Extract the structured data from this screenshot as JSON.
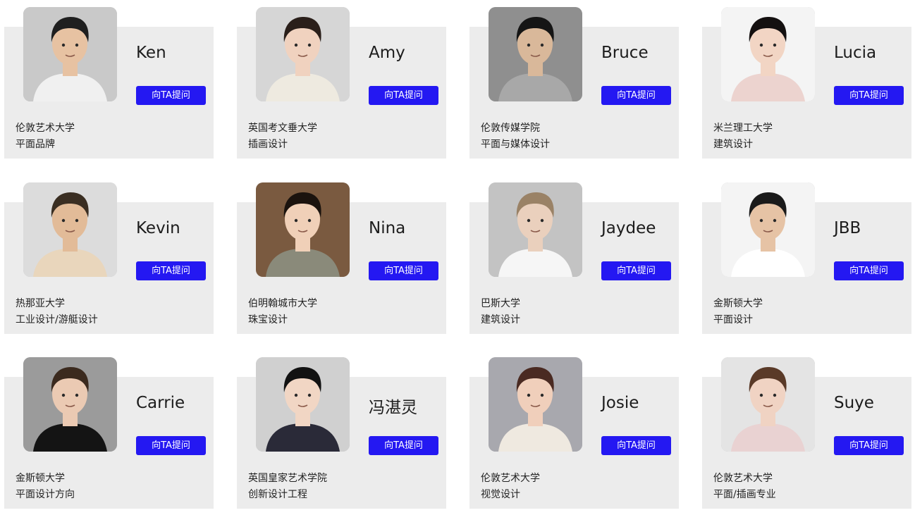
{
  "ask_label": "向TA提问",
  "accent_color": "#2418f2",
  "card_bg": "#ececec",
  "mentors": [
    {
      "name": "Ken",
      "school": "伦敦艺术大学",
      "major": "平面品牌",
      "photo": {
        "bg": "#c9c9c9",
        "skin": "#e7c2a2",
        "hair": "#1f1f1f",
        "shirt": "#f0f0f0"
      }
    },
    {
      "name": "Amy",
      "school": "英国考文垂大学",
      "major": "插画设计",
      "photo": {
        "bg": "#d6d6d6",
        "skin": "#f0d2bf",
        "hair": "#2a1f1a",
        "shirt": "#eeeae0"
      }
    },
    {
      "name": "Bruce",
      "school": "伦敦传媒学院",
      "major": "平面与媒体设计",
      "photo": {
        "bg": "#8f8f8f",
        "skin": "#d9b89a",
        "hair": "#151515",
        "shirt": "#a8a8a8"
      }
    },
    {
      "name": "Lucia",
      "school": "米兰理工大学",
      "major": "建筑设计",
      "photo": {
        "bg": "#f4f4f4",
        "skin": "#f2d5c4",
        "hair": "#141010",
        "shirt": "#ecd3cf"
      }
    },
    {
      "name": "Kevin",
      "school": "热那亚大学",
      "major": "工业设计/游艇设计",
      "photo": {
        "bg": "#dcdcdc",
        "skin": "#e2bb98",
        "hair": "#3a2e22",
        "shirt": "#e9d6bc"
      }
    },
    {
      "name": "Nina",
      "school": "伯明翰城市大学",
      "major": "珠宝设计",
      "photo": {
        "bg": "#7a5a40",
        "skin": "#f0d0b8",
        "hair": "#1b130e",
        "shirt": "#8a8a7a"
      }
    },
    {
      "name": "Jaydee",
      "school": "巴斯大学",
      "major": "建筑设计",
      "photo": {
        "bg": "#c3c3c3",
        "skin": "#ead0bd",
        "hair": "#9a8266",
        "shirt": "#f6f6f6"
      }
    },
    {
      "name": "JBB",
      "school": "金斯顿大学",
      "major": "平面设计",
      "photo": {
        "bg": "#f4f4f4",
        "skin": "#e6c3a5",
        "hair": "#1a1a1a",
        "shirt": "#ffffff"
      }
    },
    {
      "name": "Carrie",
      "school": "金斯顿大学",
      "major": "平面设计方向",
      "photo": {
        "bg": "#9b9b9b",
        "skin": "#ebcab3",
        "hair": "#3b2a1e",
        "shirt": "#141414"
      }
    },
    {
      "name": "冯湛灵",
      "school": "英国皇家艺术学院",
      "major": "创新设计工程",
      "photo": {
        "bg": "#d0d0d0",
        "skin": "#f1d6c4",
        "hair": "#121212",
        "shirt": "#2a2a38"
      }
    },
    {
      "name": "Josie",
      "school": "伦敦艺术大学",
      "major": "视觉设计",
      "photo": {
        "bg": "#a8a8ae",
        "skin": "#f0cfbb",
        "hair": "#4a2a22",
        "shirt": "#efe9e0"
      }
    },
    {
      "name": "Suye",
      "school": "伦敦艺术大学",
      "major": "平面/插画专业",
      "photo": {
        "bg": "#e4e4e4",
        "skin": "#f0d3c3",
        "hair": "#5a3a28",
        "shirt": "#e9d2d2"
      }
    }
  ]
}
